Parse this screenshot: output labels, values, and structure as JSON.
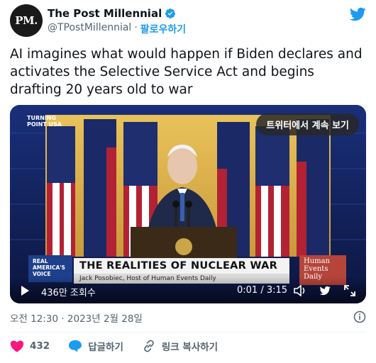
{
  "account": {
    "avatar_text": "PM.",
    "display_name": "The Post Millennial",
    "handle": "@TPostMillennial",
    "separator": "·",
    "follow_label": "팔로우하기"
  },
  "tweet": {
    "text": "AI imagines what would happen if Biden declares and activates the Selective Service Act and begins drafting 20 years old to war"
  },
  "video": {
    "watch_on_twitter": "트위터에서 계속 보기",
    "logo_turning_point_1": "TURNING",
    "logo_turning_point_2": "POINT USA",
    "broadcast_logo_1": "REAL",
    "broadcast_logo_2": "AMERICA'S",
    "broadcast_logo_3": "VOICE",
    "headline": "THE REALITIES OF NUCLEAR WAR",
    "subline": "Jack Posobiec, Host of Human Events Daily",
    "show_logo_1": "Human",
    "show_logo_2": "Events",
    "show_logo_3": "Daily",
    "views": "436만 조회수",
    "time": "0:01 / 3:15",
    "progress": 0.005
  },
  "meta": {
    "timestamp": "오전 12:30 · 2023년 2월 28일"
  },
  "actions": {
    "likes": "432",
    "reply_label": "답글하기",
    "copy_link_label": "링크 복사하기"
  },
  "colors": {
    "accent": "#1d9bf0",
    "like": "#f91880",
    "text": "#0f1419",
    "secondary": "#536471"
  }
}
